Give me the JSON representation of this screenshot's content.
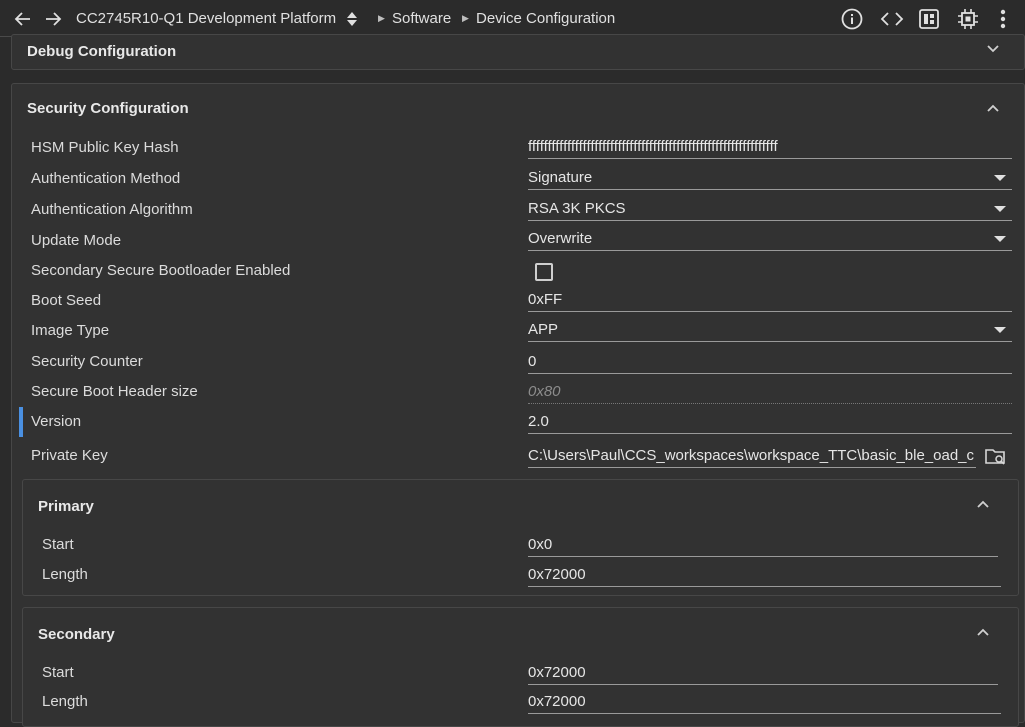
{
  "toolbar": {
    "device_title": "CC2745R10-Q1 Development Platform",
    "breadcrumb": [
      "Software",
      "Device Configuration"
    ],
    "icons": [
      "back-arrow-icon",
      "forward-arrow-icon",
      "sort-updown-icon",
      "info-icon",
      "code-brackets-icon",
      "memory-board-icon",
      "chip-icon",
      "more-vertical-icon"
    ]
  },
  "debug": {
    "title": "Debug Configuration"
  },
  "security": {
    "title": "Security Configuration",
    "rows": {
      "hsm_key_hash": {
        "label": "HSM Public Key Hash",
        "value": "ffffffffffffffffffffffffffffffffffffffffffffffffffffffffffffffff"
      },
      "auth_method": {
        "label": "Authentication Method",
        "value": "Signature"
      },
      "auth_algorithm": {
        "label": "Authentication Algorithm",
        "value": "RSA 3K PKCS"
      },
      "update_mode": {
        "label": "Update Mode",
        "value": "Overwrite"
      },
      "secondary_bootloader": {
        "label": "Secondary Secure Bootloader Enabled",
        "checked": false
      },
      "boot_seed": {
        "label": "Boot Seed",
        "value": "0xFF"
      },
      "image_type": {
        "label": "Image Type",
        "value": "APP"
      },
      "security_counter": {
        "label": "Security Counter",
        "value": "0"
      },
      "header_size": {
        "label": "Secure Boot Header size",
        "value": "0x80"
      },
      "version": {
        "label": "Version",
        "value": "2.0"
      },
      "private_key": {
        "label": "Private Key",
        "value": "C:\\Users\\Paul\\CCS_workspaces\\workspace_TTC\\basic_ble_oad_c"
      }
    }
  },
  "primary": {
    "title": "Primary",
    "start": {
      "label": "Start",
      "value": "0x0"
    },
    "length": {
      "label": "Length",
      "value": "0x72000"
    }
  },
  "secondary": {
    "title": "Secondary",
    "start": {
      "label": "Start",
      "value": "0x72000"
    },
    "length": {
      "label": "Length",
      "value": "0x72000"
    }
  },
  "colors": {
    "accent": "#4a90e2",
    "background": "#2b2b2b",
    "panel": "#323232"
  }
}
